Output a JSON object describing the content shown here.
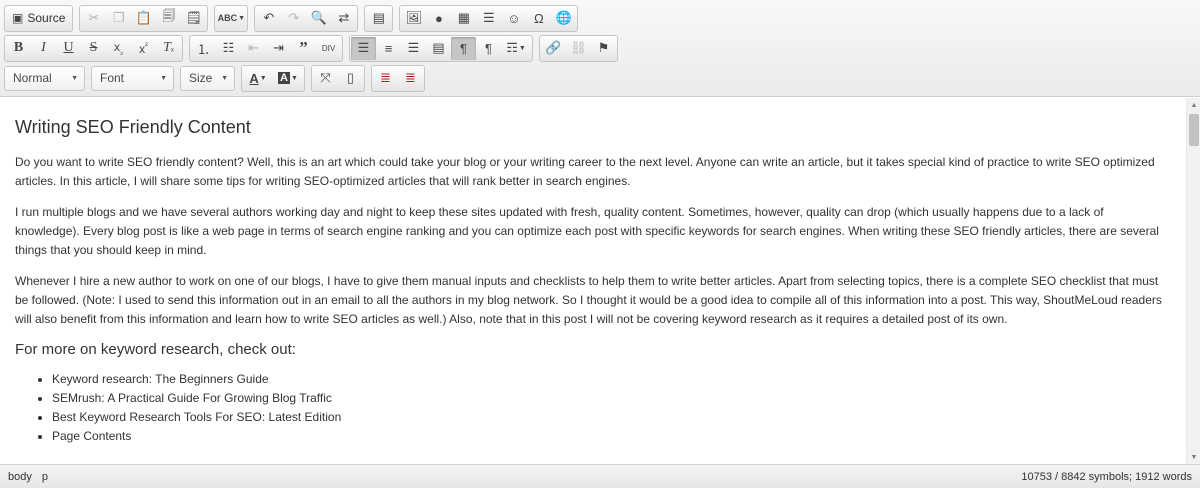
{
  "toolbar": {
    "source_label": "Source",
    "format_combo": "Normal",
    "font_combo": "Font",
    "size_combo": "Size"
  },
  "content": {
    "title": "Writing SEO Friendly Content",
    "paragraphs": [
      "Do you want to write SEO friendly content? Well, this is an art which could take your blog or your writing career to the next level. Anyone can write an article, but it takes special kind of practice to write SEO optimized articles. In this article, I will share some tips for writing SEO-optimized articles that will rank better in search engines.",
      "I run multiple blogs and we have several authors working day and night to keep these sites updated with fresh, quality content. Sometimes, however, quality can drop (which usually happens due to a lack of knowledge). Every blog post is like a web page in terms of search engine ranking and you can optimize each post with specific keywords for search engines. When writing these SEO friendly articles, there are several things that you should keep in mind.",
      "Whenever I hire a new author to work on one of our blogs, I have to give them manual inputs and checklists to help them to write better articles. Apart from selecting topics, there is a complete SEO checklist that must be followed. (Note: I used to send this information out in an email to all the authors in my blog network. So I thought it would be a good idea to compile all of this information into a post. This way, ShoutMeLoud readers will also benefit from this information and learn how to write SEO articles as well.) Also, note that in this post I will not be covering keyword research as it requires a detailed post of its own."
    ],
    "subheading": "For more on keyword research, check out:",
    "list": [
      "Keyword research: The Beginners Guide",
      "SEMrush: A Practical Guide For Growing Blog Traffic",
      "Best Keyword Research Tools For SEO: Latest Edition",
      "Page Contents"
    ]
  },
  "statusbar": {
    "path": [
      "body",
      "p"
    ],
    "counter": "10753 / 8842 symbols; 1912 words"
  }
}
